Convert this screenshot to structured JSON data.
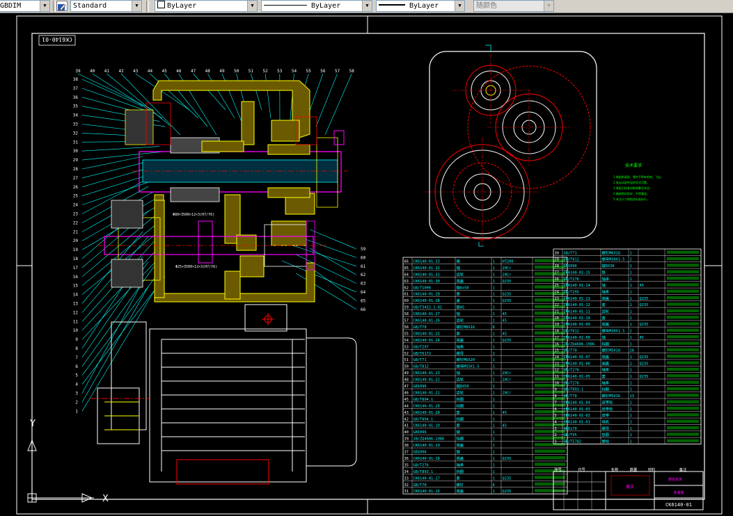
{
  "toolbar": {
    "dimstyle": "GBDIM",
    "textstyle": "Standard",
    "layer": "ByLayer",
    "linetype": "ByLayer",
    "lineweight": "ByLayer",
    "plotstyle": "随颜色"
  },
  "drawing": {
    "title_block_code": "CK6140-01",
    "rotated_code": "CK6140-01",
    "notes_title": "技术要求",
    "notes_lines": [
      "1.装配前清洗，零件不得有毛刺、飞边。",
      "2.各运动部件运转灵活可靠。",
      "3.装配后检查间隙调整至合适。",
      "4.箱体密封良好，不得漏油。",
      "5.未注尺寸按相关标准执行。"
    ],
    "leader_left_top": [
      "39",
      "40",
      "41",
      "42",
      "43",
      "44",
      "45",
      "46",
      "47",
      "48",
      "49",
      "50",
      "51",
      "52",
      "53",
      "54",
      "55",
      "56",
      "57",
      "58"
    ],
    "leader_left": [
      "38",
      "37",
      "36",
      "35",
      "34",
      "33",
      "32",
      "31",
      "30",
      "29",
      "28",
      "27",
      "26",
      "25",
      "24",
      "23",
      "22",
      "21",
      "20",
      "19",
      "18",
      "17",
      "16",
      "15",
      "14",
      "13",
      "12",
      "11",
      "10",
      "9",
      "8",
      "7",
      "6",
      "5",
      "4",
      "3",
      "2",
      "1"
    ],
    "leader_right": [
      "59",
      "60",
      "61",
      "62",
      "63",
      "64",
      "65",
      "66"
    ],
    "axis_y": "Y",
    "axis_x": "X",
    "stamp_a": "拨叉",
    "stamp_b": "数控车床",
    "stamp_c": "变速箱",
    "annot_1": "Φ80×3500×12×3(H7/f6)",
    "annot_2": "Φ25×3500×12×3(H7/f6)"
  },
  "bom_left": [
    [
      "66",
      "CK6140-01-33",
      "箱",
      "1",
      "HT200",
      ""
    ],
    [
      "65",
      "CK6140-01-32",
      "轴",
      "1",
      "20Cr",
      ""
    ],
    [
      "64",
      "CK6140-01-31",
      "齿轮",
      "1",
      "20Cr",
      ""
    ],
    [
      "63",
      "CK6140-01-30",
      "端盖",
      "1",
      "Q235",
      ""
    ],
    [
      "62",
      "GB/T1096",
      "键8x50",
      "1",
      "",
      ""
    ],
    [
      "61",
      "CK6140-01-29",
      "套",
      "1",
      "Q235",
      ""
    ],
    [
      "60",
      "CK6140-01-28",
      "盖",
      "1",
      "Q235",
      ""
    ],
    [
      "59",
      "GB/T3452.1-92",
      "圈45",
      "1",
      "",
      ""
    ],
    [
      "58",
      "CK6140-01-27",
      "轴",
      "1",
      "45",
      ""
    ],
    [
      "57",
      "CK6140-01-26",
      "齿轮",
      "1",
      "45",
      ""
    ],
    [
      "56",
      "GB/T70",
      "螺钉M8X16",
      "6",
      "",
      ""
    ],
    [
      "55",
      "CK6140-01-25",
      "套",
      "1",
      "45",
      ""
    ],
    [
      "54",
      "CK6140-01-24",
      "端盖",
      "1",
      "Q235",
      ""
    ],
    [
      "53",
      "GB/T297",
      "轴承",
      "1",
      "",
      ""
    ],
    [
      "52",
      "GB/T6172",
      "螺母",
      "1",
      "",
      ""
    ],
    [
      "51",
      "GB/T71",
      "螺钉M6X20",
      "1",
      "",
      ""
    ],
    [
      "50",
      "GB/T812",
      "螺母M55X1.5",
      "1",
      "",
      ""
    ],
    [
      "49",
      "CK6140-01-23",
      "轴",
      "1",
      "20Cr",
      ""
    ],
    [
      "48",
      "CK6140-01-22",
      "齿轮",
      "1",
      "20Cr",
      ""
    ],
    [
      "47",
      "GB1096",
      "键8X50",
      "1",
      "",
      ""
    ],
    [
      "46",
      "CK6140-01-21",
      "齿轮",
      "1",
      "20Cr",
      ""
    ],
    [
      "45",
      "GB/T894.1",
      "挡圈",
      "1",
      "",
      ""
    ],
    [
      "44",
      "CK6140-01-20",
      "挡圈",
      "1",
      "",
      ""
    ],
    [
      "43",
      "CK6140-01-20",
      "套",
      "1",
      "45",
      ""
    ],
    [
      "42",
      "GB/T894.1",
      "挡圈",
      "1",
      "",
      ""
    ],
    [
      "41",
      "CK6140-01-19",
      "套",
      "1",
      "45",
      ""
    ],
    [
      "40",
      "GB1096",
      "键",
      "1",
      "",
      ""
    ],
    [
      "39",
      "JB/ZQ4606-1986",
      "毡圈",
      "1",
      "",
      ""
    ],
    [
      "38",
      "CK6140-01-19",
      "端盖",
      "1",
      "",
      ""
    ],
    [
      "37",
      "GB1096",
      "键",
      "1",
      "",
      ""
    ],
    [
      "36",
      "CK6140-01-18",
      "端盖",
      "1",
      "Q235",
      ""
    ],
    [
      "35",
      "GB/T276",
      "轴承",
      "1",
      "",
      ""
    ],
    [
      "34",
      "GB/T893.1",
      "挡圈",
      "1",
      "",
      ""
    ],
    [
      "33",
      "CK6140-01-17",
      "套",
      "1",
      "Q235",
      ""
    ],
    [
      "32",
      "GB/T70",
      "螺钉",
      "6",
      "",
      ""
    ],
    [
      "31",
      "CK6140-01-16",
      "端盖",
      "1",
      "Q235",
      ""
    ]
  ],
  "bom_right": [
    [
      "30",
      "GB/T71",
      "螺钉M6X18",
      "1",
      "",
      ""
    ],
    [
      "29",
      "GB/T812",
      "螺母M30X1.5",
      "1",
      "",
      ""
    ],
    [
      "28",
      "GB1096",
      "键8X30",
      "1",
      "",
      ""
    ],
    [
      "27",
      "CK6140-01-15",
      "垫",
      "1",
      "",
      ""
    ],
    [
      "26",
      "GB/T276",
      "轴承",
      "1",
      "",
      ""
    ],
    [
      "25",
      "CK6140-01-14",
      "轴",
      "1",
      "45",
      ""
    ],
    [
      "24",
      "GB/T295",
      "轴承",
      "1",
      "",
      ""
    ],
    [
      "23",
      "CK6140-01-13",
      "端盖",
      "1",
      "Q235",
      ""
    ],
    [
      "22",
      "CK6140-01-12",
      "套",
      "1",
      "Q235",
      ""
    ],
    [
      "21",
      "CK6140-01-11",
      "齿轮",
      "1",
      "",
      ""
    ],
    [
      "20",
      "CK6140-01-10",
      "套",
      "1",
      "",
      ""
    ],
    [
      "19",
      "CK6140-01-09",
      "端盖",
      "1",
      "Q235",
      ""
    ],
    [
      "18",
      "GB/T812",
      "螺母M30X1.5",
      "2",
      "",
      ""
    ],
    [
      "17",
      "CK6140-01-08",
      "轴",
      "1",
      "45",
      ""
    ],
    [
      "16",
      "JB/ZQ4606-1986",
      "毡圈",
      "1",
      "",
      ""
    ],
    [
      "15",
      "GB/T70",
      "螺钉M5X18",
      "26",
      "",
      ""
    ],
    [
      "14",
      "CK6140-01-07",
      "端盖",
      "1",
      "Q235",
      ""
    ],
    [
      "13",
      "CK6140-01-06",
      "端盖",
      "1",
      "Q235",
      ""
    ],
    [
      "12",
      "GB/T276",
      "轴承",
      "1",
      "",
      ""
    ],
    [
      "11",
      "CK6140-01-05",
      "套",
      "1",
      "Q235",
      ""
    ],
    [
      "10",
      "GB/T276",
      "轴承",
      "1",
      "",
      ""
    ],
    [
      "9",
      "GB/T893.1",
      "挡圈",
      "1",
      "",
      ""
    ],
    [
      "8",
      "GB/T70",
      "螺钉M5X16",
      "13",
      "",
      ""
    ],
    [
      "7",
      "CK6140-01-04",
      "皮带轮",
      "1",
      "",
      ""
    ],
    [
      "6",
      "CK6140-01-03",
      "皮带轮",
      "1",
      "",
      ""
    ],
    [
      "5",
      "CK6140-01-02",
      "皮带",
      "1",
      "",
      ""
    ],
    [
      "4",
      "CK6140-01-01",
      "电机",
      "1",
      "",
      ""
    ],
    [
      "3",
      "GB6170",
      "螺母",
      "1",
      "",
      ""
    ],
    [
      "2",
      "GB/T95",
      "垫圈",
      "1",
      "",
      ""
    ],
    [
      "1",
      "GB/T5782",
      "螺栓",
      "1",
      "",
      ""
    ]
  ],
  "bom_header": [
    "序号",
    "代号",
    "名称",
    "数量",
    "材料",
    "备注"
  ]
}
